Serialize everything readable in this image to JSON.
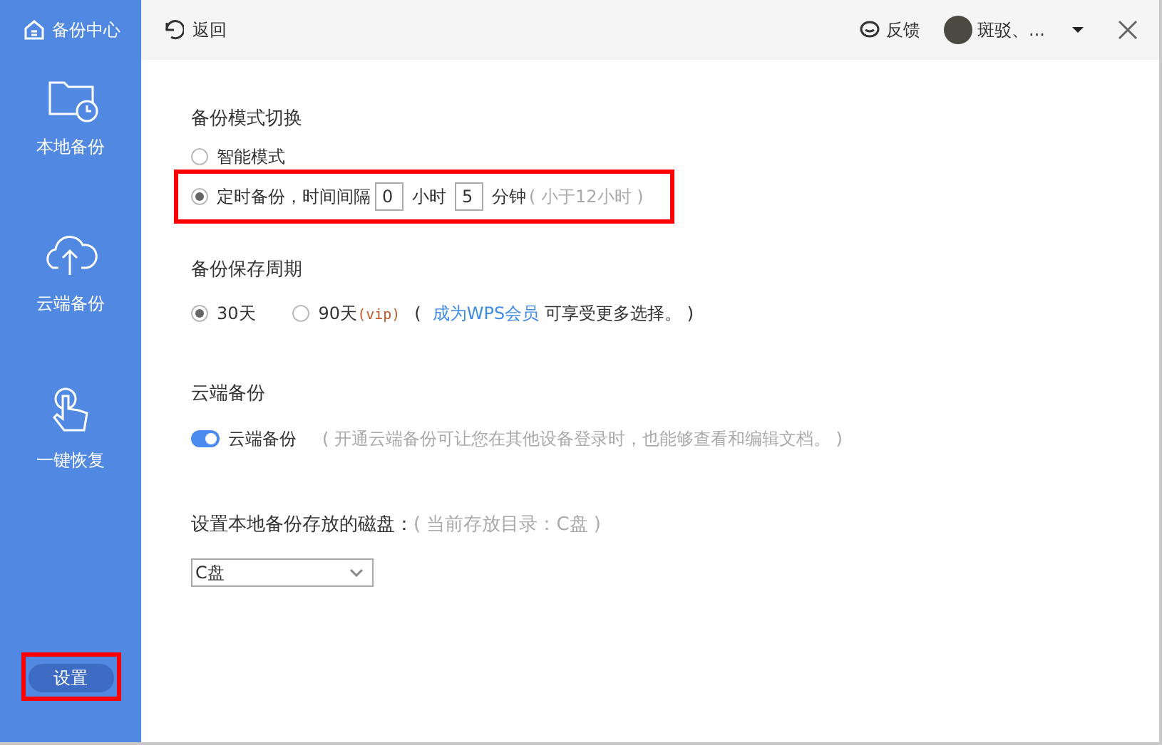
{
  "sidebar": {
    "title": "备份中心",
    "items": [
      {
        "label": "本地备份",
        "kind": "folder"
      },
      {
        "label": "云端备份",
        "kind": "cloud"
      },
      {
        "label": "一键恢复",
        "kind": "hand"
      }
    ],
    "settings_button": {
      "label": "设置",
      "highlighted": true
    }
  },
  "toolbar": {
    "back": "返回",
    "feedback": "反馈",
    "user": "斑驳、..."
  },
  "mode": {
    "title": "备份模式切换",
    "options": [
      {
        "label": "智能模式",
        "selected": false
      },
      {
        "label": "定时备份，时间间隔",
        "selected": true,
        "highlighted": true,
        "hours": "0",
        "hours_unit": "小时",
        "minutes": "5",
        "minutes_unit": "分钟",
        "hint": "( 小于12小时 )"
      }
    ]
  },
  "retention": {
    "title": "备份保存周期",
    "options": [
      {
        "label": "30天",
        "selected": true
      },
      {
        "label": "90天",
        "suffix": "(vip)",
        "selected": false
      }
    ],
    "note_open": "(",
    "note_link": "成为WPS会员",
    "note_text": "可享受更多选择。 )"
  },
  "cloud": {
    "title": "云端备份",
    "toggle": {
      "label": "云端备份",
      "on": true
    },
    "note": "( 开通云端备份可让您在其他设备登录时，也能够查看和编辑文档。 )"
  },
  "disk": {
    "title": "设置本地备份存放的磁盘：",
    "note": "( 当前存放目录：C盘 )",
    "value": "C盘"
  }
}
